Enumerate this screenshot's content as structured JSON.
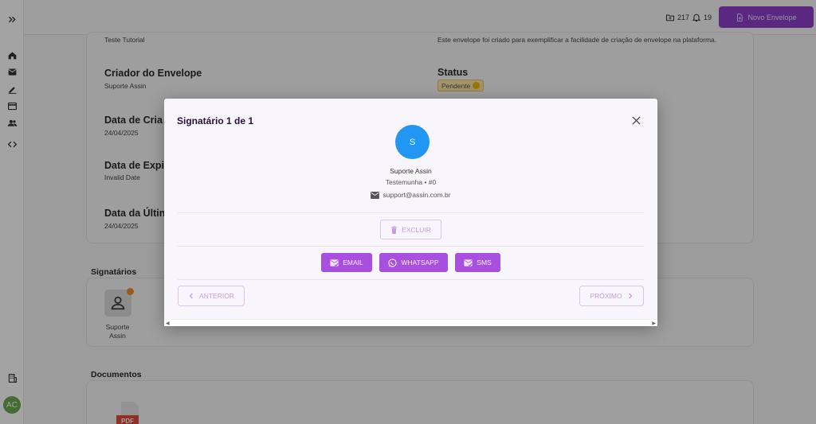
{
  "topbar": {
    "envelopes_count": "217",
    "notifications_count": "19",
    "new_envelope_label": "Novo Envelope"
  },
  "details": {
    "description_value_left": "Teste Tutorial",
    "description_value_right": "Este envelope foi criado para exemplificar a facilidade de criação de envelope na plataforma.",
    "creator_label": "Criador do Envelope",
    "creator_value": "Suporte Assin",
    "status_label": "Status",
    "status_value": "Pendente",
    "created_label": "Data de Cria",
    "created_value": "24/04/2025",
    "expiry_label": "Data de Expi",
    "expiry_value": "Invalid Date",
    "last_label": "Data da Últin",
    "last_value": "24/04/2025"
  },
  "signatories": {
    "section_title": "Signatários",
    "person_name_line1": "Suporte",
    "person_name_line2": "Assin"
  },
  "documents": {
    "section_title": "Documentos",
    "file_type": "PDF"
  },
  "user": {
    "initials": "AC"
  },
  "modal": {
    "title": "Signatário 1 de 1",
    "avatar_initial": "S",
    "name": "Suporte Assin",
    "role": "Testemunha • #0",
    "email": "support@assin.com.br",
    "delete_label": "EXCLUIR",
    "email_label": "EMAIL",
    "whatsapp_label": "WHATSAPP",
    "sms_label": "SMS",
    "prev_label": "ANTERIOR",
    "next_label": "PRÓXIMO"
  },
  "colors": {
    "primary": "#8e3fc9",
    "send_button": "#a84fe0",
    "avatar": "#2196f3",
    "status_dot": "#f2b705"
  }
}
